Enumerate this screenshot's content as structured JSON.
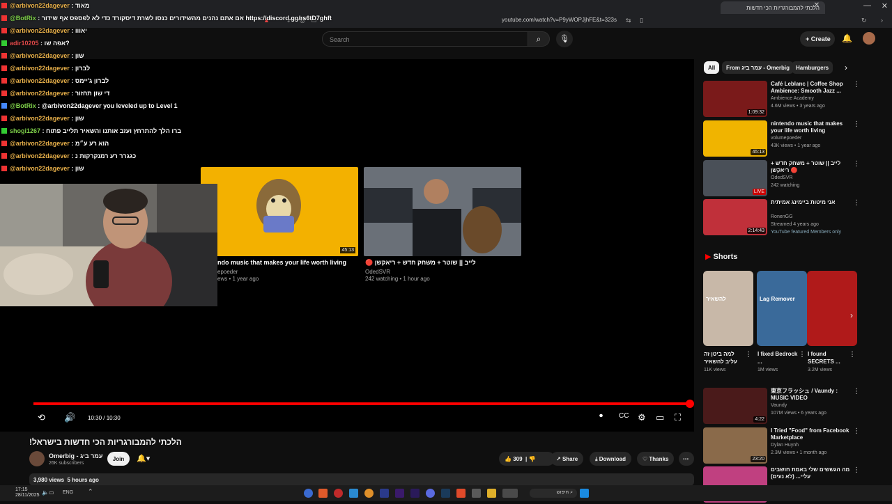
{
  "browser": {
    "tab_title": "הלכתי להמבורגריות הכי חדשות",
    "url": "youtube.com/watch?v=P9yWOPJjhFE&t=323s"
  },
  "youtube": {
    "search_placeholder": "Search",
    "create_label": "Create"
  },
  "player": {
    "time": "10:30 / 10:30",
    "progress": 1.0
  },
  "endscreen": [
    {
      "title": "ndo music that makes your life worth living",
      "channel": "epoeder",
      "meta": "ews • 1 year ago",
      "duration": "45:13"
    },
    {
      "title": "🔴 לייב || שוטר + משחק חדש + ריאקשן",
      "channel": "OdedSVR",
      "meta": "242 watching • 1 hour ago",
      "duration": ""
    }
  ],
  "video": {
    "title": "הלכתי להמבורגריות הכי חדשות בישראל!",
    "channel": "Omerbig - עמר ביג",
    "subscribers": "26K subscribers",
    "join": "Join",
    "likes": "309",
    "share": "Share",
    "download": "Download",
    "thanks": "Thanks",
    "views": "3,980 views",
    "age": "5 hours ago"
  },
  "chips": [
    "All",
    "From עמר ביג - Omerbig",
    "Hamburgers"
  ],
  "recommendations": [
    {
      "title": "Café Leblanc | Coffee Shop Ambience: Smooth Jazz ...",
      "channel": "Ambience Academy",
      "meta": "4.6M views • 3 years ago",
      "duration": "1:09:32",
      "color": "#7a1a1a"
    },
    {
      "title": "nintendo music that makes your life worth living",
      "channel": "volumepoeder",
      "meta": "43K views • 1 year ago",
      "duration": "45:13",
      "color": "#f0b400"
    },
    {
      "title": "לייב || שוטר + משחק חדש + ריאקשן 🔴",
      "channel": "OdedSVR",
      "meta": "242 watching",
      "duration": "LIVE",
      "color": "#4a5058"
    },
    {
      "title": "אני מיטות ביימינג אמיתית",
      "channel": "RonenGG",
      "meta": "Streamed 4 years ago",
      "duration": "2:14:43",
      "extra": "YouTube featured   Members only",
      "color": "#c0303a"
    },
    {
      "title": "東京フラッシュ / Vaundy : MUSIC VIDEO",
      "channel": "Vaundy",
      "meta": "107M views • 6 years ago",
      "duration": "4:22",
      "color": "#4a1a1a"
    },
    {
      "title": "I Tried \"Food\" from Facebook Marketplace",
      "channel": "Dylan Huynh",
      "meta": "2.3M views • 1 month ago",
      "duration": "23:20",
      "color": "#8a6a4a"
    },
    {
      "title": "מה הגששים שלי באמת חושבים עליי... (לא נעים)",
      "channel": "",
      "meta": "",
      "duration": "",
      "color": "#c04080"
    }
  ],
  "shorts": {
    "heading": "Shorts",
    "items": [
      {
        "title": "למה ביטן זה עליב להשאיר",
        "views": "11K views",
        "overlay": "להשאיר",
        "color": "#c8b8a8"
      },
      {
        "title": "I fixed Bedrock ...",
        "views": "1M views",
        "overlay": "Lag Remover",
        "color": "#3a6a9a"
      },
      {
        "title": "I found SECRETS ...",
        "views": "3.2M views",
        "overlay": "",
        "color": "#b01a1a"
      }
    ]
  },
  "chat": [
    {
      "user": "@arbivon22dagever",
      "msg": "מאוד",
      "color": "#e8b04a",
      "badge": "#e33"
    },
    {
      "user": "@BotRix",
      "msg": "אם אתם נהנים מהשידורים כנסו לשרת דיסקורד כדי לא לפספס אף שידור https://discord.gg/rs6tD7ghft",
      "color": "#7fd14a",
      "badge": "#e33"
    },
    {
      "user": "@arbivon22dagever",
      "msg": "יאווו",
      "color": "#e8b04a",
      "badge": "#e33"
    },
    {
      "user": "adir10205",
      "msg": "אפה שו?",
      "color": "#e04a4a",
      "badge": "#3c3"
    },
    {
      "user": "@arbivon22dagever",
      "msg": "שון",
      "color": "#e8b04a",
      "badge": "#e33"
    },
    {
      "user": "@arbivon22dagever",
      "msg": "לברון",
      "color": "#e8b04a",
      "badge": "#e33"
    },
    {
      "user": "@arbivon22dagever",
      "msg": "לברון ג'יימס",
      "color": "#e8b04a",
      "badge": "#e33"
    },
    {
      "user": "@arbivon22dagever",
      "msg": "די שון תחזור",
      "color": "#e8b04a",
      "badge": "#e33"
    },
    {
      "user": "@BotRix",
      "msg": "@arbivon22dagever you leveled up to Level 1",
      "color": "#7fd14a",
      "badge": "#48f"
    },
    {
      "user": "@arbivon22dagever",
      "msg": "שון",
      "color": "#e8b04a",
      "badge": "#e33"
    },
    {
      "user": "shogi1267",
      "msg": "ברו הלך להתרחץ ועזב אותנו והשאיר תלייב פתוח",
      "color": "#7fd14a",
      "badge": "#3c3"
    },
    {
      "user": "@arbivon22dagever",
      "msg": "הוא רע ע״מ",
      "color": "#e8b04a",
      "badge": "#e33"
    },
    {
      "user": "@arbivon22dagever",
      "msg": "כגגרר רע רמנקרקות נ",
      "color": "#e8b04a",
      "badge": "#e33"
    },
    {
      "user": "@arbivon22dagever",
      "msg": "שון",
      "color": "#e8b04a",
      "badge": "#e33"
    }
  ],
  "taskbar": {
    "time": "17:15",
    "date": "28/11/2025",
    "lang": "ENG",
    "search": "חיפוש"
  }
}
